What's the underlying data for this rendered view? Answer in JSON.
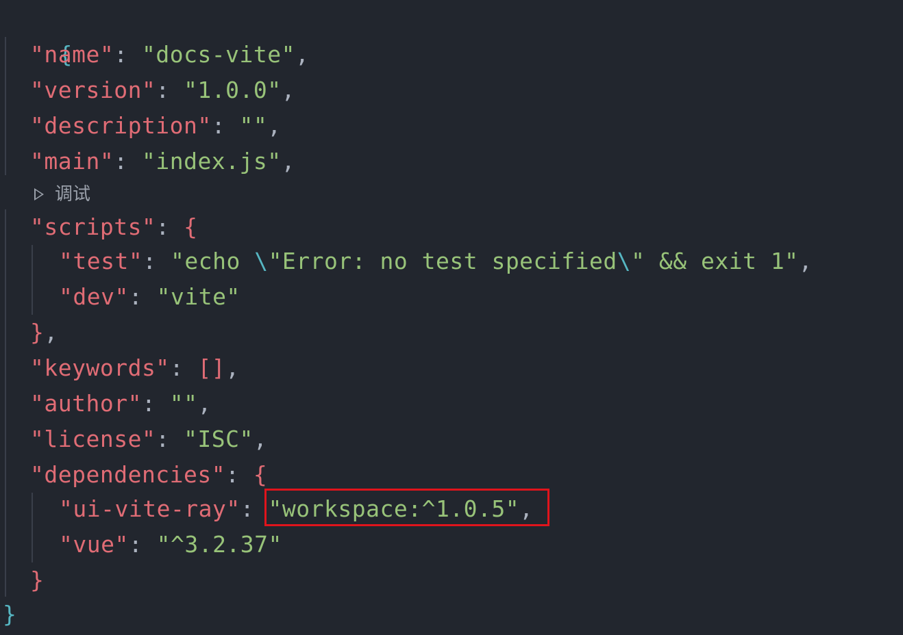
{
  "codelens": {
    "debug_label": "调试"
  },
  "lines": {
    "open_brace": "{",
    "name": {
      "key": "\"name\"",
      "colon": ": ",
      "value": "\"docs-vite\"",
      "comma": ","
    },
    "version": {
      "key": "\"version\"",
      "colon": ": ",
      "value": "\"1.0.0\"",
      "comma": ","
    },
    "description": {
      "key": "\"description\"",
      "colon": ": ",
      "value": "\"\"",
      "comma": ","
    },
    "main": {
      "key": "\"main\"",
      "colon": ": ",
      "value": "\"index.js\"",
      "comma": ","
    },
    "scripts": {
      "key": "\"scripts\"",
      "colon": ": ",
      "brace": "{"
    },
    "test": {
      "key": "\"test\"",
      "colon": ": ",
      "value_a": "\"echo ",
      "esc1": "\\",
      "value_b": "\"Error: no test specified",
      "esc2": "\\",
      "value_c": "\" && exit 1\"",
      "comma": ","
    },
    "dev": {
      "key": "\"dev\"",
      "colon": ": ",
      "value": "\"vite\""
    },
    "scripts_close": {
      "brace": "}",
      "comma": ","
    },
    "keywords": {
      "key": "\"keywords\"",
      "colon": ": ",
      "value": "[]",
      "comma": ","
    },
    "author": {
      "key": "\"author\"",
      "colon": ": ",
      "value": "\"\"",
      "comma": ","
    },
    "license": {
      "key": "\"license\"",
      "colon": ": ",
      "value": "\"ISC\"",
      "comma": ","
    },
    "dependencies": {
      "key": "\"dependencies\"",
      "colon": ": ",
      "brace": "{"
    },
    "ui_vite_ray": {
      "key": "\"ui-vite-ray\"",
      "colon": ": ",
      "value": "\"workspace:^1.0.5\"",
      "comma": ","
    },
    "vue": {
      "key": "\"vue\"",
      "colon": ": ",
      "value": "\"^3.2.37\""
    },
    "dependencies_close": {
      "brace": "}"
    },
    "close_brace": "}"
  },
  "colors": {
    "background": "#22262e",
    "key": "#e06c75",
    "string": "#98c379",
    "punctuation": "#abb2bf",
    "outer_brace": "#56b6c2",
    "highlight_box": "#e0141c"
  }
}
